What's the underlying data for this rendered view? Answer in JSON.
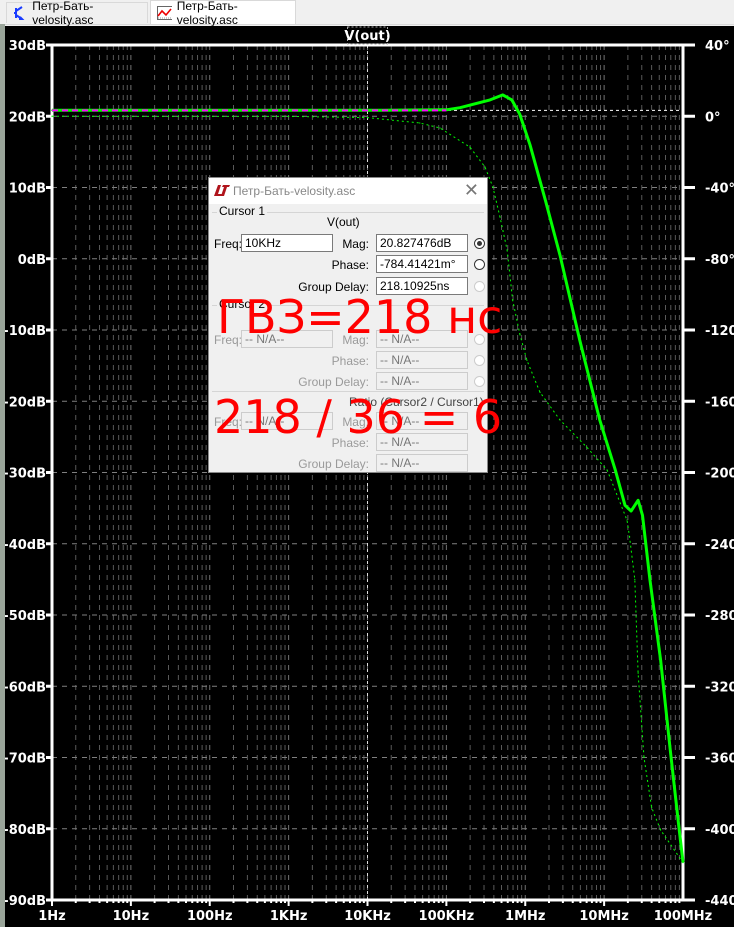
{
  "tabs": [
    {
      "label": "Петр-Бать-velosity.asc",
      "icon": "schematic-transistor-icon"
    },
    {
      "label": "Петр-Бать-velosity.asc",
      "icon": "waveform-plot-icon",
      "active": true
    }
  ],
  "plot": {
    "trace_label": "V(out)",
    "colors": {
      "background": "#000000",
      "trace": "#00ff00",
      "cursor_marker": "#ff00ff",
      "grid": "#808080"
    },
    "cursor_frequency": "10KHz"
  },
  "chart_data": {
    "type": "line",
    "title": "V(out)",
    "x_scale": "log",
    "xlim": [
      1,
      100000000
    ],
    "x_ticks": [
      "1Hz",
      "10Hz",
      "100Hz",
      "1KHz",
      "10KHz",
      "100KHz",
      "1MHz",
      "10MHz",
      "100MHz"
    ],
    "y_left_lim": [
      -90,
      30
    ],
    "y_left_ticks": [
      "30dB",
      "20dB",
      "10dB",
      "0dB",
      "-10dB",
      "-20dB",
      "-30dB",
      "-40dB",
      "-50dB",
      "-60dB",
      "-70dB",
      "-80dB",
      "-90dB"
    ],
    "y_right_lim": [
      -440,
      40
    ],
    "y_right_ticks": [
      "40°",
      "0°",
      "-40°",
      "-80°",
      "-120°",
      "-160°",
      "-200°",
      "-240°",
      "-280°",
      "-320°",
      "-360°",
      "-400°",
      "-440°"
    ],
    "grid": true,
    "series": [
      {
        "quantity": "magnitude_dB",
        "axis": "left",
        "style": "solid",
        "x": [
          1,
          1000,
          10000,
          100000,
          149000,
          357000,
          520000,
          676000,
          851000,
          1150000,
          1800000,
          2760000,
          4900000,
          8800000,
          13800000,
          18400000,
          22000000,
          27000000,
          30700000,
          38000000,
          52000000,
          69000000,
          87000000,
          100000000
        ],
        "y": [
          20.83,
          20.83,
          20.83,
          20.9,
          21.2,
          22.3,
          23.0,
          22.3,
          20.3,
          16,
          8.2,
          0.5,
          -11.4,
          -22.6,
          -29.6,
          -34.6,
          -35.4,
          -33.9,
          -36,
          -45,
          -56.3,
          -69,
          -78.9,
          -84.7
        ]
      },
      {
        "quantity": "phase_deg",
        "axis": "right",
        "style": "dashed",
        "x": [
          1,
          1000,
          10000,
          46000,
          83000,
          199000,
          309000,
          389000,
          479000,
          589000,
          692000,
          851000,
          1050000,
          1540000,
          2760000,
          6000000,
          10900000,
          19500000,
          21000000,
          24500000,
          27000000,
          32000000,
          40000000,
          52000000,
          100000000
        ],
        "y": [
          0,
          -0.1,
          -0.78,
          -3.8,
          -6.6,
          -17.3,
          -28.5,
          -39.8,
          -56.6,
          -75,
          -103,
          -122,
          -137,
          -155,
          -170.5,
          -185.7,
          -198.6,
          -226.7,
          -236,
          -260,
          -312.6,
          -360,
          -388,
          -400.7,
          -419
        ]
      }
    ]
  },
  "dialog": {
    "title": "Петр-Бать-velosity.asc",
    "cursor1": {
      "group": "Cursor 1",
      "trace": "V(out)",
      "freq_label": "Freq:",
      "freq": "10KHz",
      "mag_label": "Mag:",
      "mag": "20.827476dB",
      "phase_label": "Phase:",
      "phase": "-784.41421m°",
      "gd_label": "Group Delay:",
      "gd": "218.10925ns"
    },
    "cursor2": {
      "group": "Cursor 2",
      "freq_label": "Freq:",
      "freq": "-- N/A--",
      "mag_label": "Mag:",
      "mag": "-- N/A--",
      "phase_label": "Phase:",
      "phase": "-- N/A--",
      "gd_label": "Group Delay:",
      "gd": "-- N/A--"
    },
    "ratio": {
      "group": "Ratio (Cursor2 / Cursor1)",
      "freq_label": "Freq:",
      "freq": "-- N/A--",
      "mag_label": "Mag:",
      "mag": "-- N/A--",
      "phase_label": "Phase:",
      "phase": "-- N/A--",
      "gd_label": "Group Delay:",
      "gd": "-- N/A--"
    }
  },
  "annotations": {
    "line1": "ГВЗ=218 нс",
    "line2": "218 / 36 = 6",
    "color": "#ff0000"
  }
}
